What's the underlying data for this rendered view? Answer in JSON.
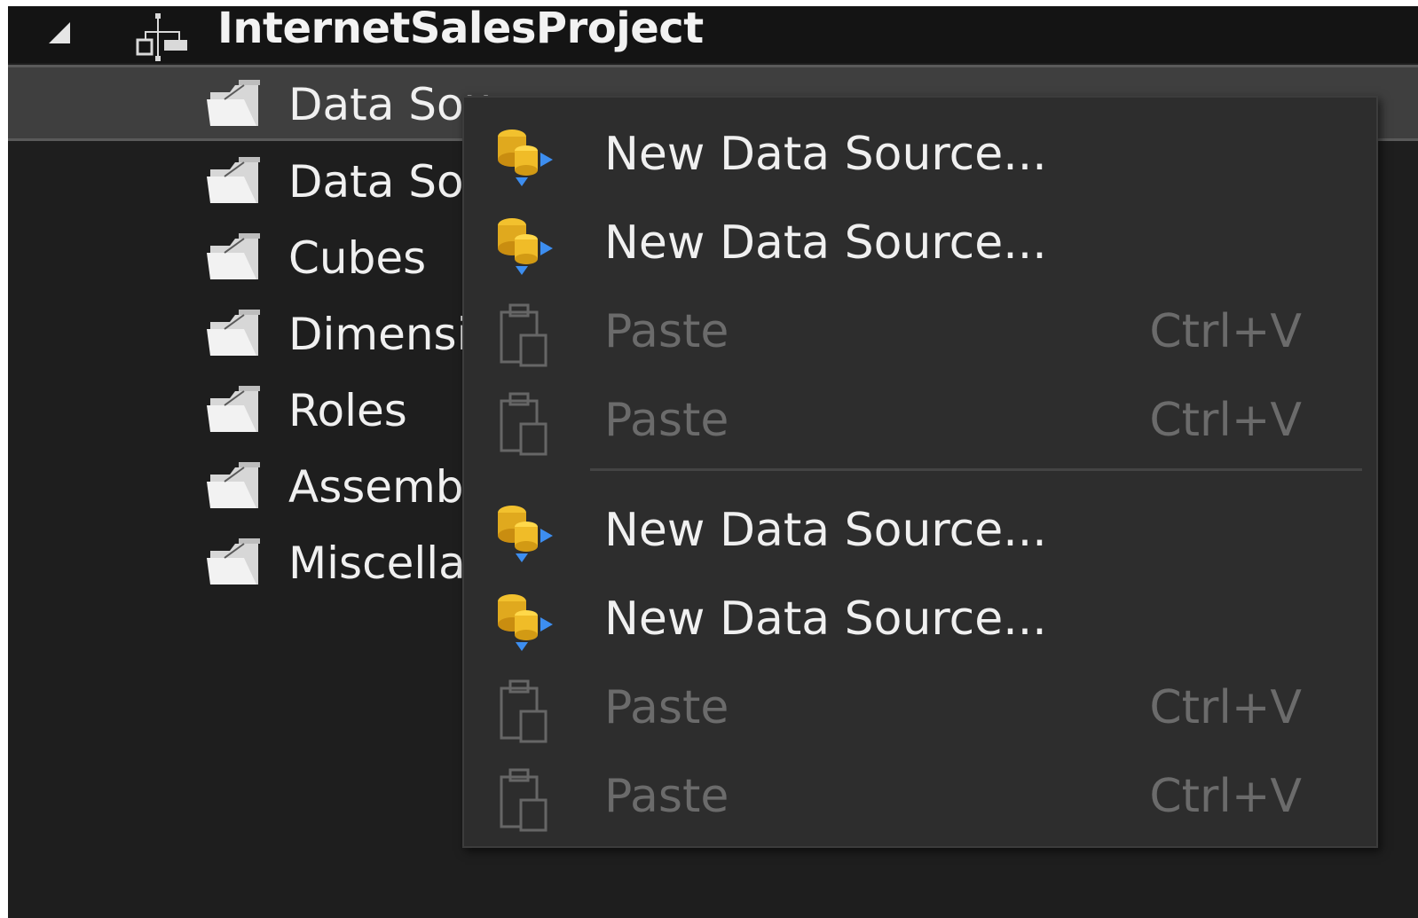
{
  "tree": {
    "root": {
      "label": "InternetSalesProject",
      "icon": "project-icon"
    },
    "items": [
      {
        "label": "Data Sou",
        "icon": "folder-icon",
        "selected": true
      },
      {
        "label": "Data Sou",
        "icon": "folder-icon"
      },
      {
        "label": "Cubes",
        "icon": "folder-icon"
      },
      {
        "label": "Dimensi",
        "icon": "folder-icon"
      },
      {
        "label": "Roles",
        "icon": "folder-icon"
      },
      {
        "label": "Assemb",
        "icon": "folder-icon"
      },
      {
        "label": "Miscella",
        "icon": "folder-icon"
      }
    ]
  },
  "context_menu": {
    "items": [
      {
        "label": "New Data Source...",
        "icon": "new-data-source-icon",
        "enabled": true
      },
      {
        "label": "New Data Source...",
        "icon": "new-data-source-icon",
        "enabled": true
      },
      {
        "label": "Paste",
        "shortcut": "Ctrl+V",
        "icon": "paste-icon",
        "enabled": false
      },
      {
        "label": "Paste",
        "shortcut": "Ctrl+V",
        "icon": "paste-icon",
        "enabled": false
      },
      {
        "label": "New Data Source...",
        "icon": "new-data-source-icon",
        "enabled": true
      },
      {
        "label": "New Data Source...",
        "icon": "new-data-source-icon",
        "enabled": true
      },
      {
        "label": "Paste",
        "shortcut": "Ctrl+V",
        "icon": "paste-icon",
        "enabled": false
      },
      {
        "label": "Paste",
        "shortcut": "Ctrl+V",
        "icon": "paste-icon",
        "enabled": false
      }
    ]
  },
  "colors": {
    "background": "#1e1e1e",
    "menu_background": "#2d2d2d",
    "selection": "#3f3f3f",
    "disabled_text": "#6b6b6b",
    "text": "#f0f0f0"
  }
}
